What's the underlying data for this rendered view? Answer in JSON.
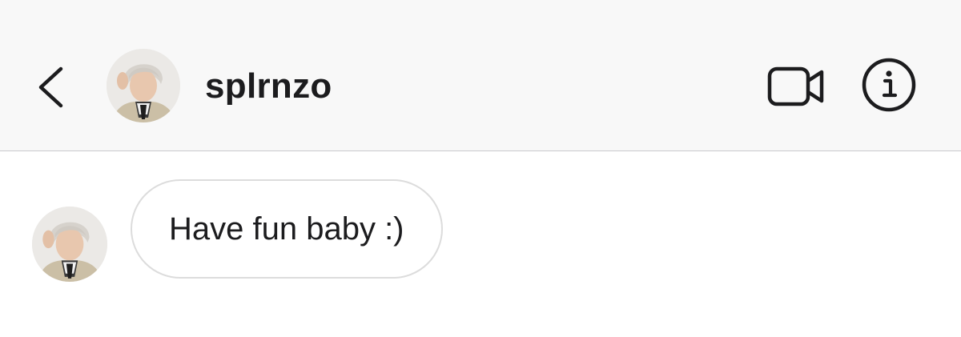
{
  "header": {
    "username": "splrnzo",
    "back_icon": "chevron-left-icon",
    "video_icon": "video-camera-icon",
    "info_icon": "info-icon",
    "avatar": "profile-photo"
  },
  "messages": [
    {
      "text": "Have fun baby :)",
      "avatar": "profile-photo",
      "direction": "incoming"
    }
  ],
  "colors": {
    "header_bg": "#f8f8f8",
    "divider": "#c9c9cc",
    "text": "#1c1c1e",
    "bubble_border": "#dcdcdc"
  }
}
